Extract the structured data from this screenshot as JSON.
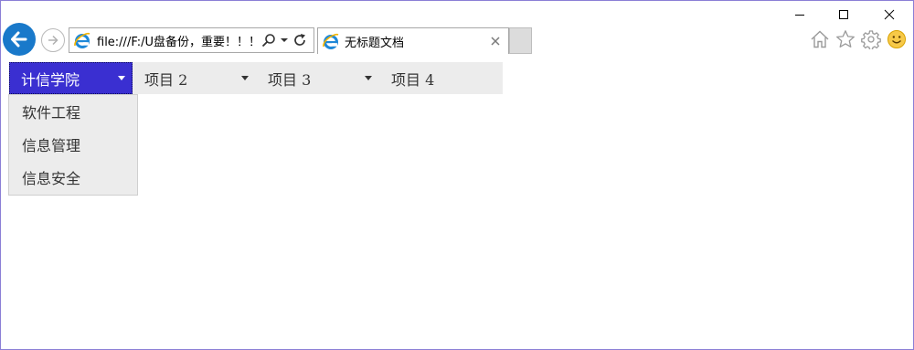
{
  "browser": {
    "address": "file:///F:/U盘备份，重要！！！",
    "tab_title": "无标题文档",
    "accent_color": "#1979ca"
  },
  "icons": {
    "back": "back-arrow-icon",
    "forward": "forward-arrow-icon",
    "site": "ie-logo-icon",
    "search": "search-icon",
    "dropdown": "chevron-down-icon",
    "refresh": "refresh-icon",
    "close_tab": "close-icon",
    "home": "home-icon",
    "favorites": "star-icon",
    "settings": "gear-icon",
    "feedback": "smiley-icon",
    "minimize": "minimize-icon",
    "maximize": "maximize-icon",
    "close_window": "close-icon"
  },
  "menu": {
    "active_color": "#3a2fd1",
    "items": [
      {
        "label": "计信学院"
      },
      {
        "label": "项目 2"
      },
      {
        "label": "项目 3"
      },
      {
        "label": "项目 4"
      }
    ],
    "dropdown": [
      {
        "label": "软件工程"
      },
      {
        "label": "信息管理"
      },
      {
        "label": "信息安全"
      }
    ]
  }
}
